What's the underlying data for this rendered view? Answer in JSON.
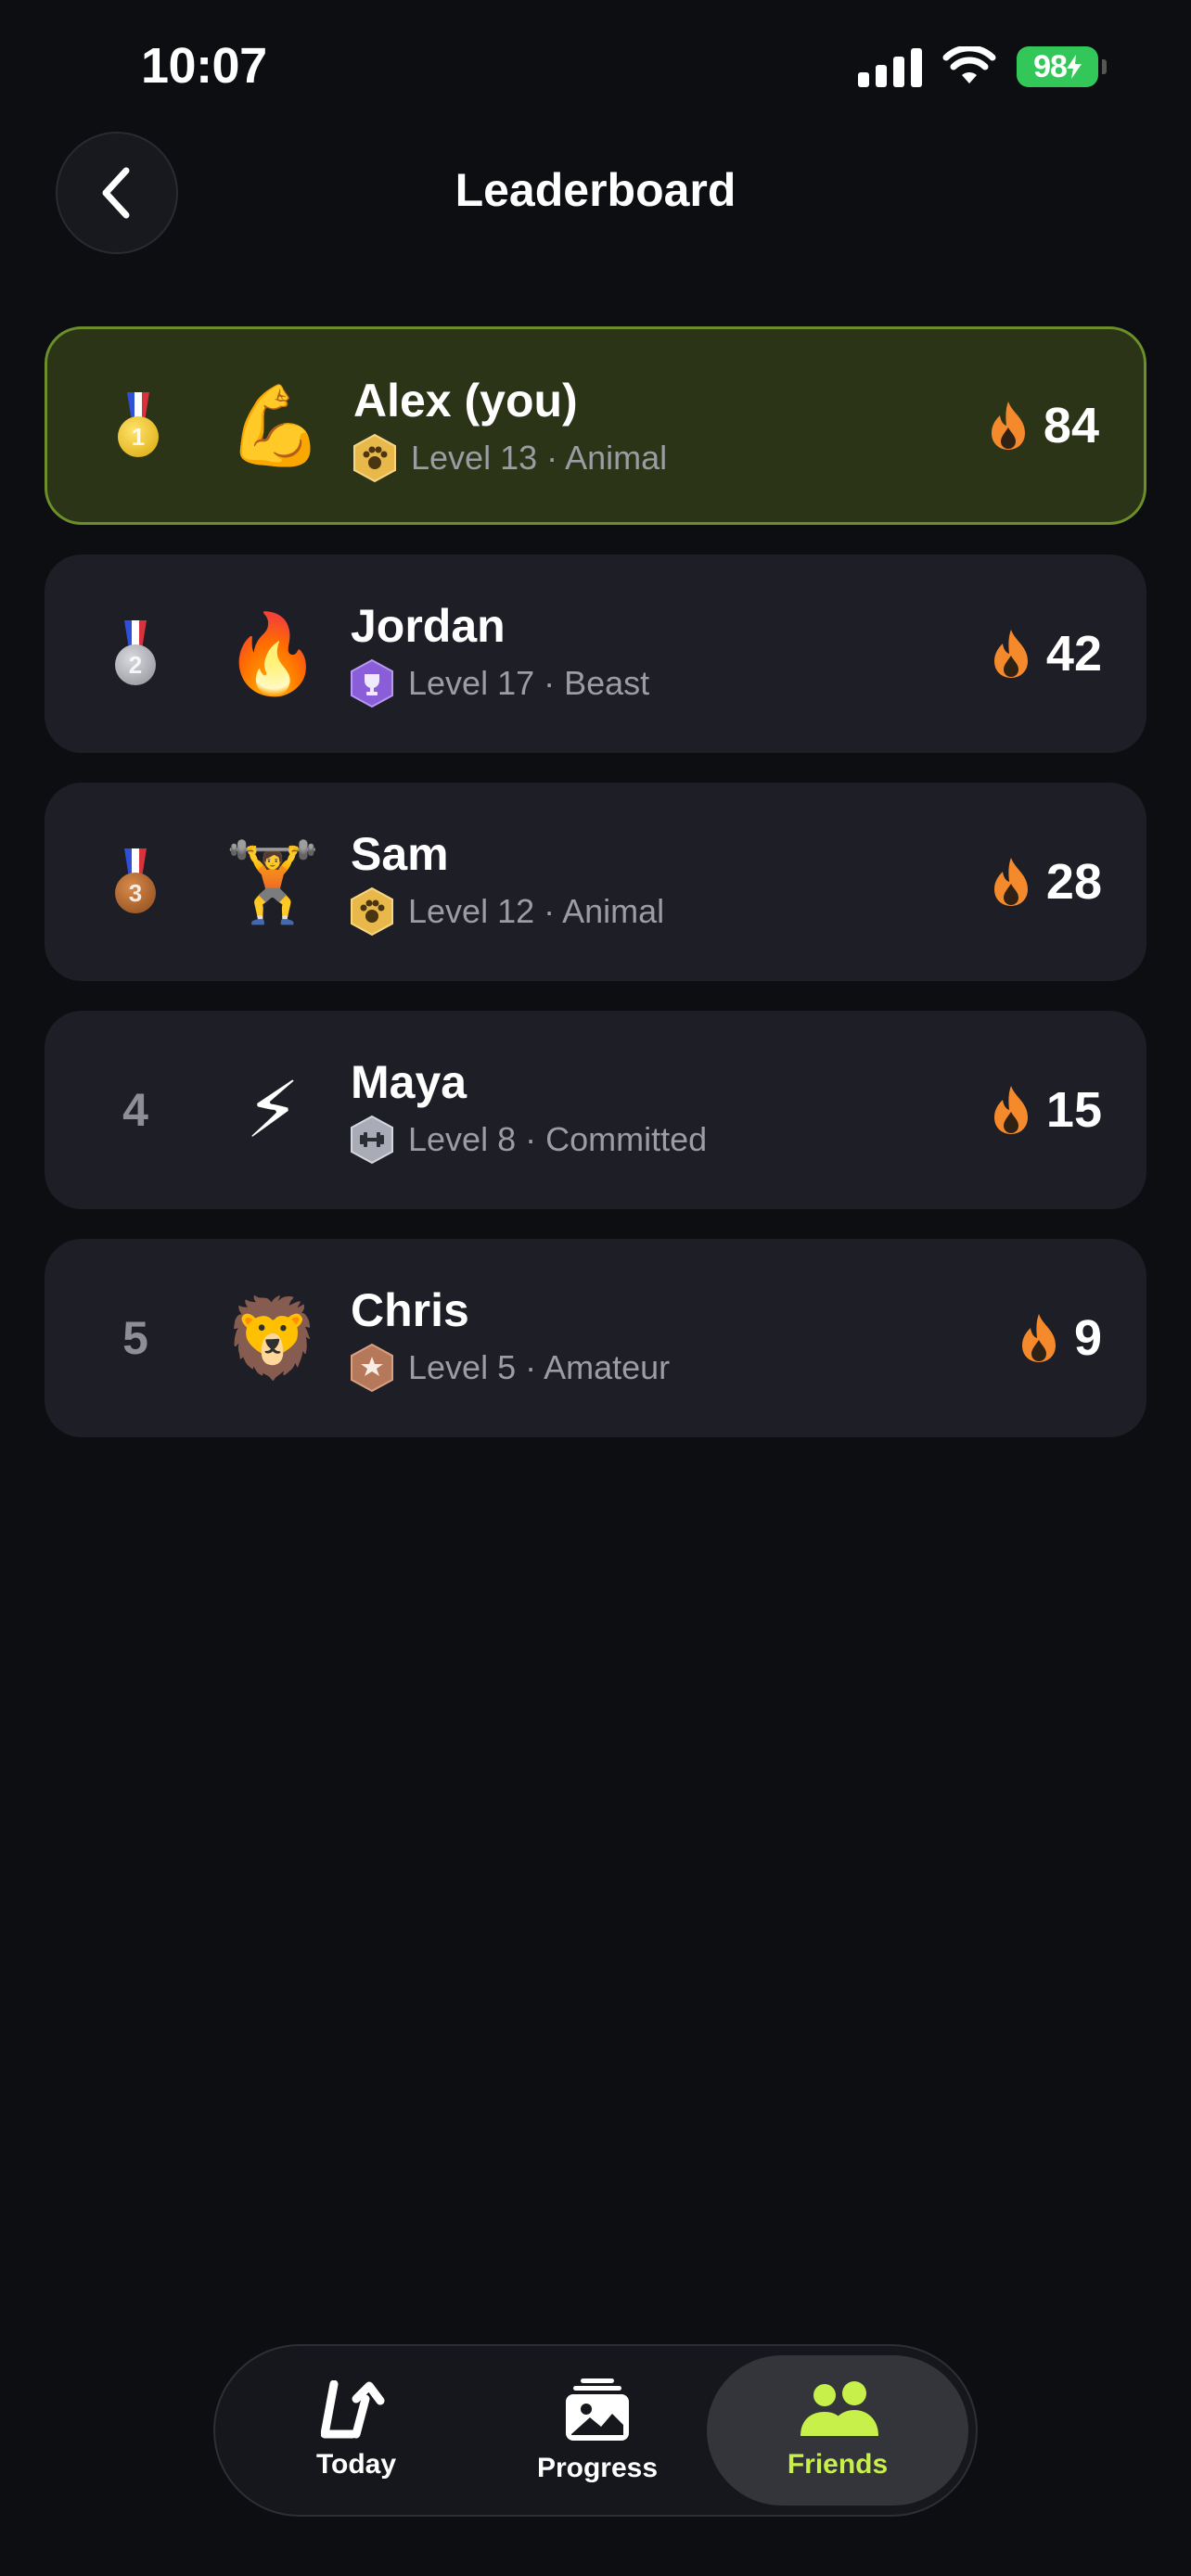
{
  "status_bar": {
    "time": "10:07",
    "battery": "98"
  },
  "header": {
    "title": "Leaderboard",
    "back_icon": "chevron-left-icon"
  },
  "colors": {
    "background": "#0d0e12",
    "card": "#1d1e26",
    "you_card": "#2c3417",
    "you_border": "#6c8f2a",
    "accent": "#c8f04a",
    "flame": "#f58a2c"
  },
  "leaderboard": [
    {
      "rank": "1",
      "medal": "gold",
      "avatar": "💪",
      "name": "Alex (you)",
      "level": "Level 13 · Animal",
      "badge": "paw",
      "streak": "84"
    },
    {
      "rank": "2",
      "medal": "silver",
      "avatar": "🔥",
      "name": "Jordan",
      "level": "Level 17 · Beast",
      "badge": "trophy",
      "streak": "42"
    },
    {
      "rank": "3",
      "medal": "bronze",
      "avatar": "🏋️",
      "name": "Sam",
      "level": "Level 12 · Animal",
      "badge": "paw",
      "streak": "28"
    },
    {
      "rank": "4",
      "medal": "",
      "avatar": "⚡",
      "name": "Maya",
      "level": "Level 8 · Committed",
      "badge": "dumbbell",
      "streak": "15"
    },
    {
      "rank": "5",
      "medal": "",
      "avatar": "🦁",
      "name": "Chris",
      "level": "Level 5 · Amateur",
      "badge": "star",
      "streak": "9"
    }
  ],
  "tabbar": {
    "tabs": [
      {
        "label": "Today",
        "icon": "today-icon"
      },
      {
        "label": "Progress",
        "icon": "progress-icon"
      },
      {
        "label": "Friends",
        "icon": "friends-icon",
        "active": true
      }
    ]
  }
}
